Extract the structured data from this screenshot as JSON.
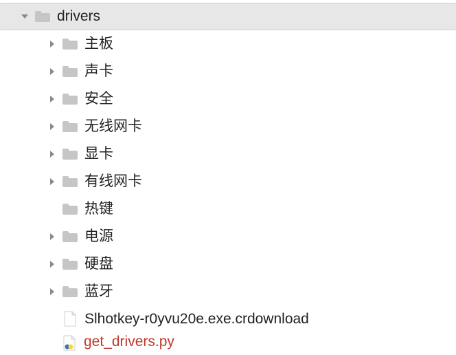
{
  "tree": {
    "root": {
      "label": "drivers",
      "expanded": true
    },
    "children": [
      {
        "type": "folder",
        "label": "主板",
        "hasDisclosure": true
      },
      {
        "type": "folder",
        "label": "声卡",
        "hasDisclosure": true
      },
      {
        "type": "folder",
        "label": "安全",
        "hasDisclosure": true
      },
      {
        "type": "folder",
        "label": "无线网卡",
        "hasDisclosure": true
      },
      {
        "type": "folder",
        "label": "显卡",
        "hasDisclosure": true
      },
      {
        "type": "folder",
        "label": "有线网卡",
        "hasDisclosure": true
      },
      {
        "type": "folder",
        "label": "热键",
        "hasDisclosure": false
      },
      {
        "type": "folder",
        "label": "电源",
        "hasDisclosure": true
      },
      {
        "type": "folder",
        "label": "硬盘",
        "hasDisclosure": true
      },
      {
        "type": "folder",
        "label": "蓝牙",
        "hasDisclosure": true
      },
      {
        "type": "file",
        "label": "Slhotkey-r0yvu20e.exe.crdownload",
        "hasDisclosure": false
      }
    ],
    "partial": {
      "type": "pyfile",
      "label": "get_drivers.py",
      "hasDisclosure": false,
      "special": true
    }
  },
  "icons": {
    "folderColor": "#c6c6c6",
    "fileColor": "#ffffff",
    "fileStroke": "#cfcfcf"
  }
}
